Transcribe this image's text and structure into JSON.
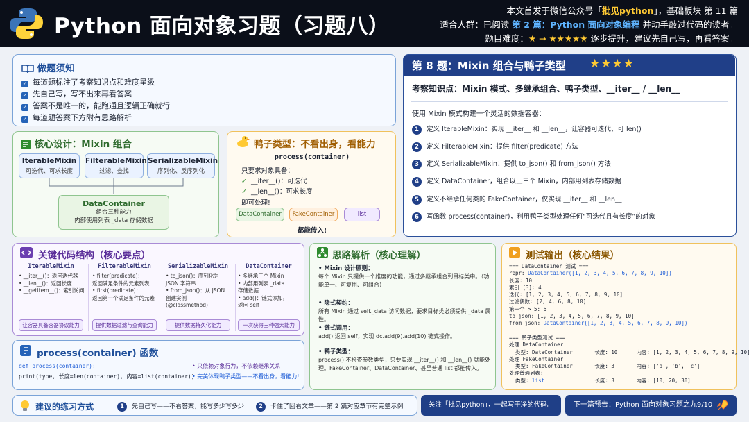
{
  "header": {
    "title": "Python 面向对象习题（习题八）",
    "meta_line1_prefix": "本文首发于微信公众号「",
    "meta_line1_brand": "批见python",
    "meta_line1_suffix": "」，基础板块 第 11 篇",
    "meta_line2_prefix": "适合人群：已阅读 ",
    "meta_line2_link": "第 2 篇：Python 面向对象编程",
    "meta_line2_suffix": " 并动手敲过代码的读者。",
    "meta_line3_prefix": "题目难度：",
    "meta_line3_stars": "★ → ★★★★★",
    "meta_line3_suffix": " 逐步提升，建议先自己写，再看答案。"
  },
  "notes": {
    "title": "做题须知",
    "items": [
      "每道题标注了考察知识点和难度星级",
      "先自己写，写不出来再看答案",
      "答案不是唯一的，能跑通且逻辑正确就行",
      "每道题答案下方附有思路解析"
    ]
  },
  "design": {
    "title": "核心设计：Mixin 组合",
    "mixins": [
      {
        "name": "IterableMixin",
        "desc": "可迭代、可求长度"
      },
      {
        "name": "FilterableMixin",
        "desc": "过滤、查找"
      },
      {
        "name": "SerializableMixin",
        "desc": "序列化、反序列化"
      }
    ],
    "container_name": "DataContainer",
    "container_desc1": "组合三种能力",
    "container_desc2": "内部使用列表 _data 存储数据"
  },
  "duck": {
    "title": "鸭子类型：不看出身，看能力",
    "signature": "process(container)",
    "need": "只要求对象具备：",
    "req1": "__iter__()：可迭代",
    "req2": "__len__()：可求长度",
    "ok": "即可处理!",
    "pills": [
      "DataContainer",
      "FakeContainer",
      "list"
    ],
    "footer": "都能传入!"
  },
  "problem": {
    "title": "第 8 题：Mixin 组合与鸭子类型",
    "stars": "★★★★",
    "knowledge": "考察知识点：Mixin 模式、多继承组合、鸭子类型、__iter__ / __len__",
    "lead": "使用 Mixin 模式构建一个灵活的数据容器：",
    "steps": [
      {
        "n": "1",
        "text": "定义 IterableMixin：实现 __iter__ 和 __len__，让容器可迭代、可 len()"
      },
      {
        "n": "2",
        "text": "定义 FilterableMixin：提供 filter(predicate) 方法"
      },
      {
        "n": "3",
        "text": "定义 SerializableMixin：提供 to_json() 和 from_json() 方法"
      },
      {
        "n": "4",
        "text": "定义 DataContainer，组合以上三个 Mixin，内部用列表存储数据"
      },
      {
        "n": "5",
        "text": "定义不继承任何类的 FakeContainer，仅实现 __iter__ 和 __len__"
      },
      {
        "n": "6",
        "text": "写函数 process(container)，利用鸭子类型处理任何“可迭代且有长度”的对象"
      }
    ]
  },
  "structure": {
    "title": "关键代码结构（核心要点）",
    "columns": [
      {
        "head": "IterableMixin",
        "items": [
          "• __iter__()：返回迭代器",
          "• __len__()：返回长度",
          "• __getitem__()：索引访问"
        ],
        "tag": "让容器具备容器协议能力"
      },
      {
        "head": "FilterableMixin",
        "items": [
          "• filter(predicate)：",
          "  返回满足条件的元素列表",
          "• first(predicate)：",
          "  返回第一个满足条件的元素"
        ],
        "tag": "提供数据过滤与查询能力"
      },
      {
        "head": "SerializableMixin",
        "items": [
          "• to_json()：序列化为",
          "  JSON 字符串",
          "• from_json()：从 JSON",
          "  创建实例",
          "  (@classmethod)"
        ],
        "tag": "提供数据持久化能力"
      },
      {
        "head": "DataContainer",
        "items": [
          "• 多继承三个 Mixin",
          "• 内部用列表 _data",
          "  存储数据",
          "• add()：链式添加，",
          "  返回 self"
        ],
        "tag": "一次获得三种强大能力"
      }
    ]
  },
  "process_fn": {
    "title": "process(container) 函数",
    "code1": "def process(container):",
    "code2": "    print(type, 长度=len(container), 内容=list(container))",
    "b1": "• 只依赖对象行为，不依赖继承关系",
    "b2": "• 完美体现鸭子类型——不看出身，看能力!"
  },
  "think": {
    "title": "思路解析（核心理解）",
    "blocks": [
      {
        "head": "• Mixin 设计原则：",
        "body": "每个 Mixin 只提供一个维度的功能，通过多继承组合到目标类中。（功能单一、可复用、可组合）"
      },
      {
        "head": "• 隐式契约：",
        "body": "所有 Mixin 通过 self._data 访问数据，要求目标类必须提供 _data 属性。"
      },
      {
        "head": "• 链式调用：",
        "body": "add() 返回 self，实现 dc.add(9).add(10) 链式操作。"
      },
      {
        "head": "• 鸭子类型：",
        "body": "process() 不检查参数类型，只要实现 __iter__() 和 __len__() 就能处理。FakeContainer、DataContainer、甚至普通 list 都能传入。"
      }
    ]
  },
  "output": {
    "title": "测试输出（核心结果）",
    "lines": [
      "=== DataContainer 测试 ===",
      "repr: DataContainer([1, 2, 3, 4, 5, 6, 7, 8, 9, 10])",
      "长度: 10",
      "索引 [3]: 4",
      "迭代: [1, 2, 3, 4, 5, 6, 7, 8, 9, 10]",
      "过滤偶数: [2, 4, 6, 8, 10]",
      "第一个 > 5: 6",
      "to_json: [1, 2, 3, 4, 5, 6, 7, 8, 9, 10]",
      "from_json: DataContainer([1, 2, 3, 4, 5, 6, 7, 8, 9, 10])",
      "",
      "=== 鸭子类型测试 ===",
      "处理 DataContainer:",
      "  类型: DataContainer       长度: 10      内容: [1, 2, 3, 4, 5, 6, 7, 8, 9, 10]",
      "处理 FakeContainer:",
      "  类型: FakeContainer       长度: 3       内容: ['a', 'b', 'c']",
      "处理普通列表:",
      "  类型: list                长度: 3       内容: [10, 20, 30]"
    ]
  },
  "footer": {
    "practice_title": "建议的练习方式",
    "p1": "先自己写——不看答案，能写多少写多少",
    "p2": "卡住了回看文章——第 2 篇对应章节有完整示例",
    "follow": "关注「批见python」，一起写干净的代码。",
    "next": "下一篇预告：Python 面向对象习题之九9/10"
  },
  "colors": {
    "dark": "#0b0f19",
    "accent_blue": "#203f88",
    "accent_yellow": "#ffc933",
    "green": "#2e6b2e",
    "purple": "#5b2f9a"
  }
}
